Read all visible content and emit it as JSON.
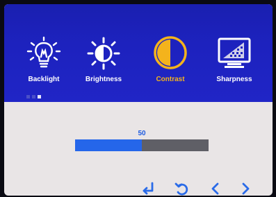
{
  "menu": {
    "items": [
      {
        "label": "Backlight",
        "icon": "lightbulb-icon"
      },
      {
        "label": "Brightness",
        "icon": "sun-icon"
      },
      {
        "label": "Contrast",
        "icon": "contrast-icon",
        "selected": true
      },
      {
        "label": "Sharpness",
        "icon": "sharpness-monitor-icon"
      }
    ],
    "page_indicator": {
      "count": 3,
      "active": 3
    }
  },
  "contrast_slider": {
    "value": "50",
    "level_fraction": 0.5
  },
  "nav_buttons": [
    {
      "icon": "enter-icon"
    },
    {
      "icon": "back-icon"
    },
    {
      "icon": "left-arrow-icon"
    },
    {
      "icon": "right-arrow-icon"
    }
  ],
  "colors": {
    "header_blue": "#1d22be",
    "selected_label": "#f4b31c",
    "slider_fill": "#2566ea",
    "slider_track": "#5f5f66",
    "value_text": "#1e5be0"
  }
}
